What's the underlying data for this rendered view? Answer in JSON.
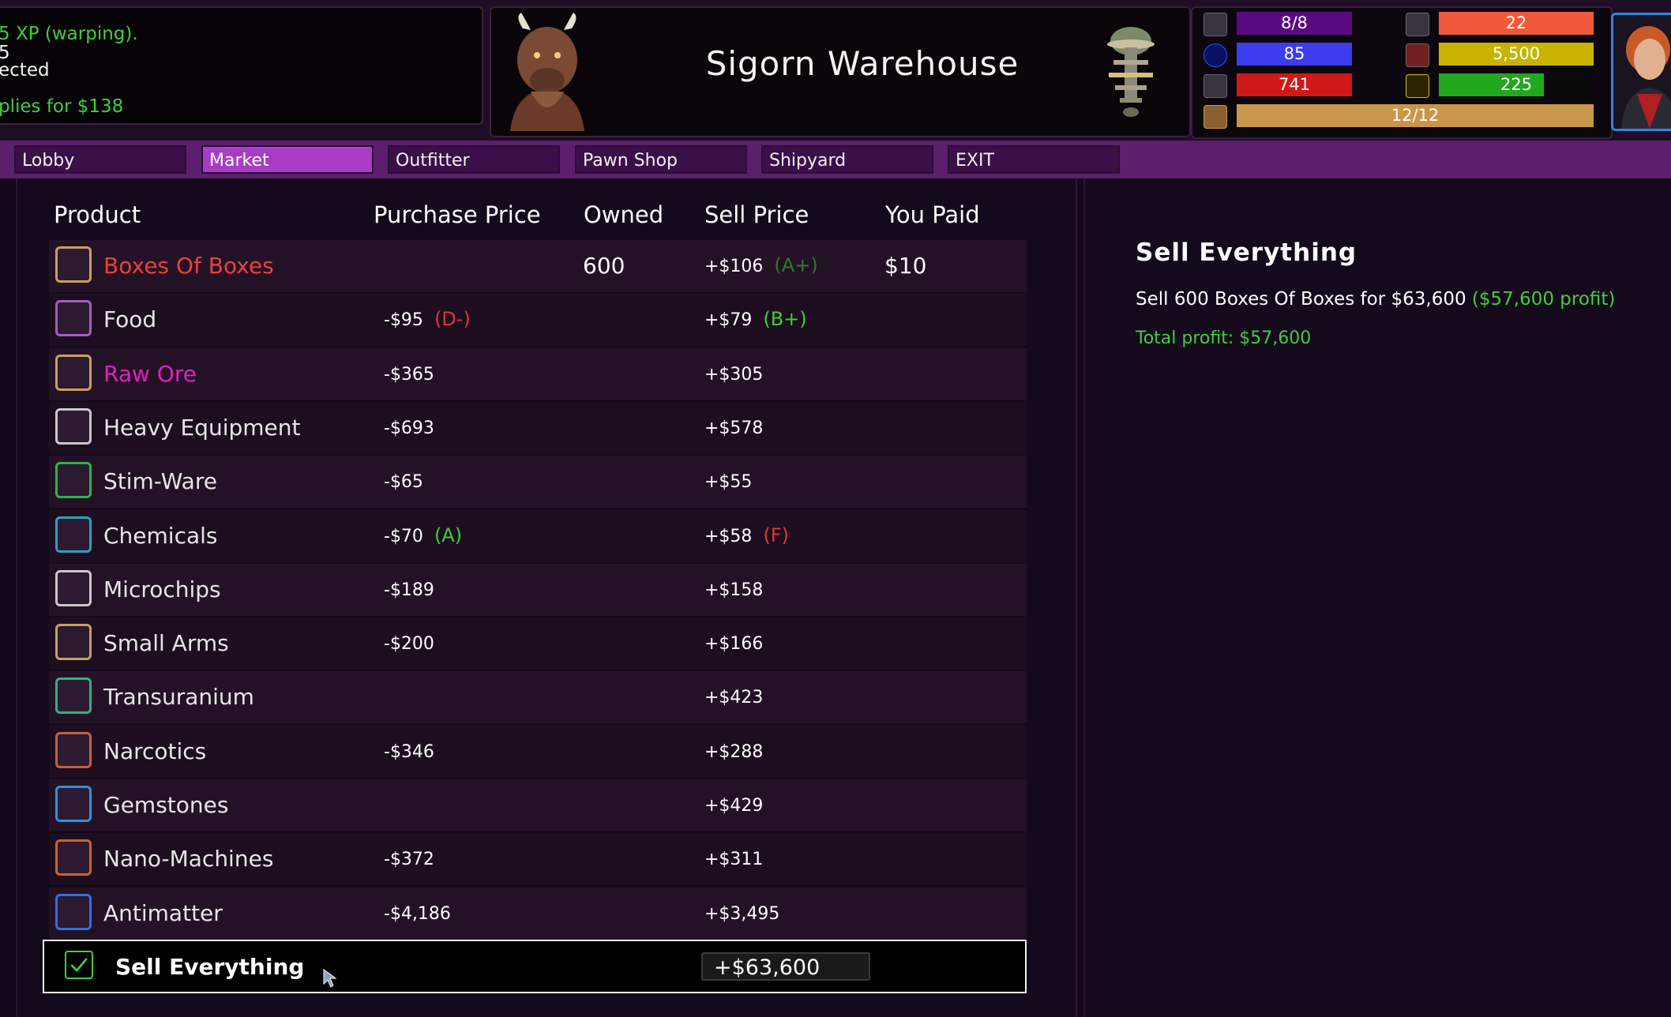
{
  "log": {
    "lines": [
      {
        "text": "5 XP (warping).",
        "color": "green"
      },
      {
        "text": "5",
        "color": "white"
      },
      {
        "text": "ected",
        "color": "white"
      },
      {
        "text": "plies for $138",
        "color": "green"
      }
    ]
  },
  "location": {
    "title": "Sigorn Warehouse",
    "portrait_icon": "minotaur-portrait",
    "station_icon": "space-station-icon"
  },
  "stats": {
    "left": [
      {
        "icon": "crew-icon",
        "value": "8/8",
        "color": "#5a0a80",
        "fill": 1.0
      },
      {
        "icon": "shield-icon",
        "value": "85",
        "color": "#3d3cf0",
        "fill": 1.0
      },
      {
        "icon": "hull-icon",
        "value": "741",
        "color": "#d01818",
        "fill": 1.0
      }
    ],
    "right": [
      {
        "icon": "weapons-icon",
        "value": "22",
        "color": "#f05a3a",
        "fill": 1.0
      },
      {
        "icon": "fuel-icon",
        "value": "5,500",
        "color": "#c8b400",
        "fill": 1.0
      },
      {
        "icon": "speed-icon",
        "value": "225",
        "color": "#22a81e",
        "fill": 0.68
      }
    ],
    "cargo": {
      "icon": "cargo-icon",
      "value": "12/12",
      "color": "#c8964a",
      "fill": 1.0
    }
  },
  "tabs": [
    {
      "label": "Lobby",
      "active": false
    },
    {
      "label": "Market",
      "active": true
    },
    {
      "label": "Outfitter",
      "active": false
    },
    {
      "label": "Pawn Shop",
      "active": false
    },
    {
      "label": "Shipyard",
      "active": false
    },
    {
      "label": "EXIT",
      "active": false
    }
  ],
  "table": {
    "headers": {
      "product": "Product",
      "purchase_price": "Purchase Price",
      "owned": "Owned",
      "sell_price": "Sell Price",
      "you_paid": "You Paid"
    },
    "rows": [
      {
        "name": "Boxes Of Boxes",
        "name_color": "#e84040",
        "icon": "box-icon",
        "icon_border": "#c8a060",
        "purchase": "",
        "purchase_grade": "",
        "purchase_grade_color": "",
        "owned": "600",
        "sell": "+$106",
        "sell_grade": "(A+)",
        "sell_grade_color": "dim",
        "paid": "$10"
      },
      {
        "name": "Food",
        "name_color": "#e6e6e6",
        "icon": "food-icon",
        "icon_border": "#a060c0",
        "purchase": "-$95",
        "purchase_grade": "(D-)",
        "purchase_grade_color": "red",
        "owned": "",
        "sell": "+$79",
        "sell_grade": "(B+)",
        "sell_grade_color": "green",
        "paid": ""
      },
      {
        "name": "Raw Ore",
        "name_color": "#e020c0",
        "icon": "ore-icon",
        "icon_border": "#c8a060",
        "purchase": "-$365",
        "purchase_grade": "",
        "purchase_grade_color": "",
        "owned": "",
        "sell": "+$305",
        "sell_grade": "",
        "sell_grade_color": "",
        "paid": ""
      },
      {
        "name": "Heavy Equipment",
        "name_color": "#e6e6e6",
        "icon": "gear-icon",
        "icon_border": "#c8c8c8",
        "purchase": "-$693",
        "purchase_grade": "",
        "purchase_grade_color": "",
        "owned": "",
        "sell": "+$578",
        "sell_grade": "",
        "sell_grade_color": "",
        "paid": ""
      },
      {
        "name": "Stim-Ware",
        "name_color": "#e6e6e6",
        "icon": "pill-icon",
        "icon_border": "#30b050",
        "purchase": "-$65",
        "purchase_grade": "",
        "purchase_grade_color": "",
        "owned": "",
        "sell": "+$55",
        "sell_grade": "",
        "sell_grade_color": "",
        "paid": ""
      },
      {
        "name": "Chemicals",
        "name_color": "#e6e6e6",
        "icon": "flask-icon",
        "icon_border": "#30a0c0",
        "purchase": "-$70",
        "purchase_grade": "(A)",
        "purchase_grade_color": "green",
        "owned": "",
        "sell": "+$58",
        "sell_grade": "(F)",
        "sell_grade_color": "red",
        "paid": ""
      },
      {
        "name": "Microchips",
        "name_color": "#e6e6e6",
        "icon": "chip-icon",
        "icon_border": "#c8c8c8",
        "purchase": "-$189",
        "purchase_grade": "",
        "purchase_grade_color": "",
        "owned": "",
        "sell": "+$158",
        "sell_grade": "",
        "sell_grade_color": "",
        "paid": ""
      },
      {
        "name": "Small Arms",
        "name_color": "#e6e6e6",
        "icon": "crossed-swords-icon",
        "icon_border": "#c8a060",
        "purchase": "-$200",
        "purchase_grade": "",
        "purchase_grade_color": "",
        "owned": "",
        "sell": "+$166",
        "sell_grade": "",
        "sell_grade_color": "",
        "paid": ""
      },
      {
        "name": "Transuranium",
        "name_color": "#e6e6e6",
        "icon": "atom-star-icon",
        "icon_border": "#30b080",
        "purchase": "",
        "purchase_grade": "",
        "purchase_grade_color": "",
        "owned": "",
        "sell": "+$423",
        "sell_grade": "",
        "sell_grade_color": "",
        "paid": ""
      },
      {
        "name": "Narcotics",
        "name_color": "#e6e6e6",
        "icon": "syringe-icon",
        "icon_border": "#c06040",
        "purchase": "-$346",
        "purchase_grade": "",
        "purchase_grade_color": "",
        "owned": "",
        "sell": "+$288",
        "sell_grade": "",
        "sell_grade_color": "",
        "paid": ""
      },
      {
        "name": "Gemstones",
        "name_color": "#e6e6e6",
        "icon": "gem-icon",
        "icon_border": "#3090e0",
        "purchase": "",
        "purchase_grade": "",
        "purchase_grade_color": "",
        "owned": "",
        "sell": "+$429",
        "sell_grade": "",
        "sell_grade_color": "",
        "paid": ""
      },
      {
        "name": "Nano-Machines",
        "name_color": "#e6e6e6",
        "icon": "nano-icon",
        "icon_border": "#d06020",
        "purchase": "-$372",
        "purchase_grade": "",
        "purchase_grade_color": "",
        "owned": "",
        "sell": "+$311",
        "sell_grade": "",
        "sell_grade_color": "",
        "paid": ""
      },
      {
        "name": "Antimatter",
        "name_color": "#e6e6e6",
        "icon": "antimatter-icon",
        "icon_border": "#3070e0",
        "purchase": "-$4,186",
        "purchase_grade": "",
        "purchase_grade_color": "",
        "owned": "",
        "sell": "+$3,495",
        "sell_grade": "",
        "sell_grade_color": "",
        "paid": ""
      }
    ],
    "sell_everything": {
      "label": "Sell Everything",
      "total": "+$63,600",
      "checked": true
    }
  },
  "summary": {
    "title": "Sell Everything",
    "line": "Sell 600 Boxes Of Boxes for $63,600",
    "profit": "($57,600 profit)",
    "total": "Total profit: $57,600"
  }
}
